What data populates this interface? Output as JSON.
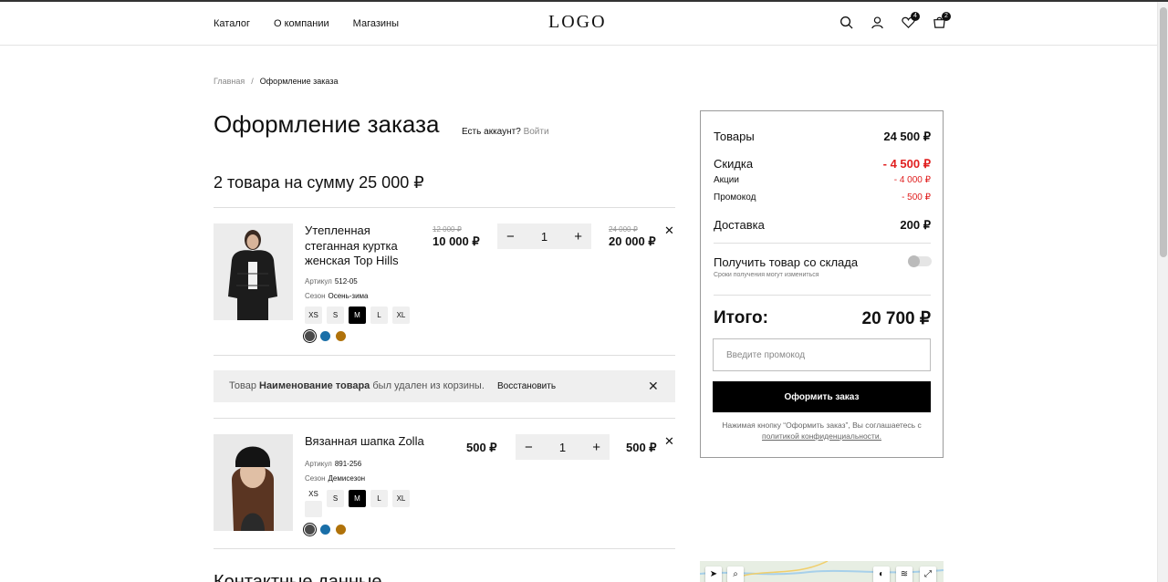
{
  "header": {
    "nav": [
      "Каталог",
      "О компании",
      "Магазины"
    ],
    "logo": "LOGO",
    "favorites_count": "4",
    "cart_count": "2"
  },
  "breadcrumb": {
    "home": "Главная",
    "separator": "/",
    "current": "Оформление заказа"
  },
  "page": {
    "title": "Оформление заказа",
    "account_question": "Есть аккаунт?",
    "login": "Войти",
    "summary": "2 товара на сумму 25 000 ₽"
  },
  "items": [
    {
      "name": "Утепленная стеганная куртка женская Top Hills",
      "article_label": "Артикул",
      "article": "512-05",
      "season_label": "Сезон",
      "season": "Осень-зима",
      "sizes": [
        "XS",
        "S",
        "M",
        "L",
        "XL"
      ],
      "selected_size": "M",
      "colors": [
        "#4a4a4a",
        "#1a6fa8",
        "#b0720a"
      ],
      "old_price": "12 000 ₽",
      "price": "10 000 ₽",
      "qty": "1",
      "old_total": "24 000 ₽",
      "total": "20 000 ₽"
    },
    {
      "name": "Вязанная шапка Zolla",
      "article_label": "Артикул",
      "article": "891-256",
      "season_label": "Сезон",
      "season": "Демисезон",
      "sizes": [
        "XS",
        "S",
        "M",
        "L",
        "XL"
      ],
      "selected_size": "M",
      "colors": [
        "#4a4a4a",
        "#1a6fa8",
        "#b0720a"
      ],
      "price": "500 ₽",
      "qty": "1",
      "total": "500 ₽"
    }
  ],
  "notice": {
    "prefix": "Товар",
    "product": "Наименование товара",
    "suffix": "был удален из корзины.",
    "restore": "Восстановить"
  },
  "contacts_title": "Контактные данные",
  "order_summary": {
    "goods_label": "Товары",
    "goods": "24 500 ₽",
    "discount_label": "Скидка",
    "discount": "- 4 500 ₽",
    "promo_sale_label": "Акции",
    "promo_sale": "- 4 000 ₽",
    "promocode_label": "Промокод",
    "promocode": "- 500 ₽",
    "delivery_label": "Доставка",
    "delivery": "200 ₽",
    "stock_label": "Получить товар со склада",
    "stock_note": "Сроки получения могут измениться",
    "stock_enabled": false,
    "total_label": "Итого:",
    "total": "20 700 ₽",
    "promo_placeholder": "Введите промокод",
    "order_button": "Оформить заказ",
    "consent_text": "Нажимая кнопку “Оформить заказ”, Вы соглашаетесь с",
    "consent_link": "политикой конфиденциальности."
  },
  "colors": {
    "accent": "#000000",
    "discount": "#e02020",
    "surface": "#efefef"
  }
}
